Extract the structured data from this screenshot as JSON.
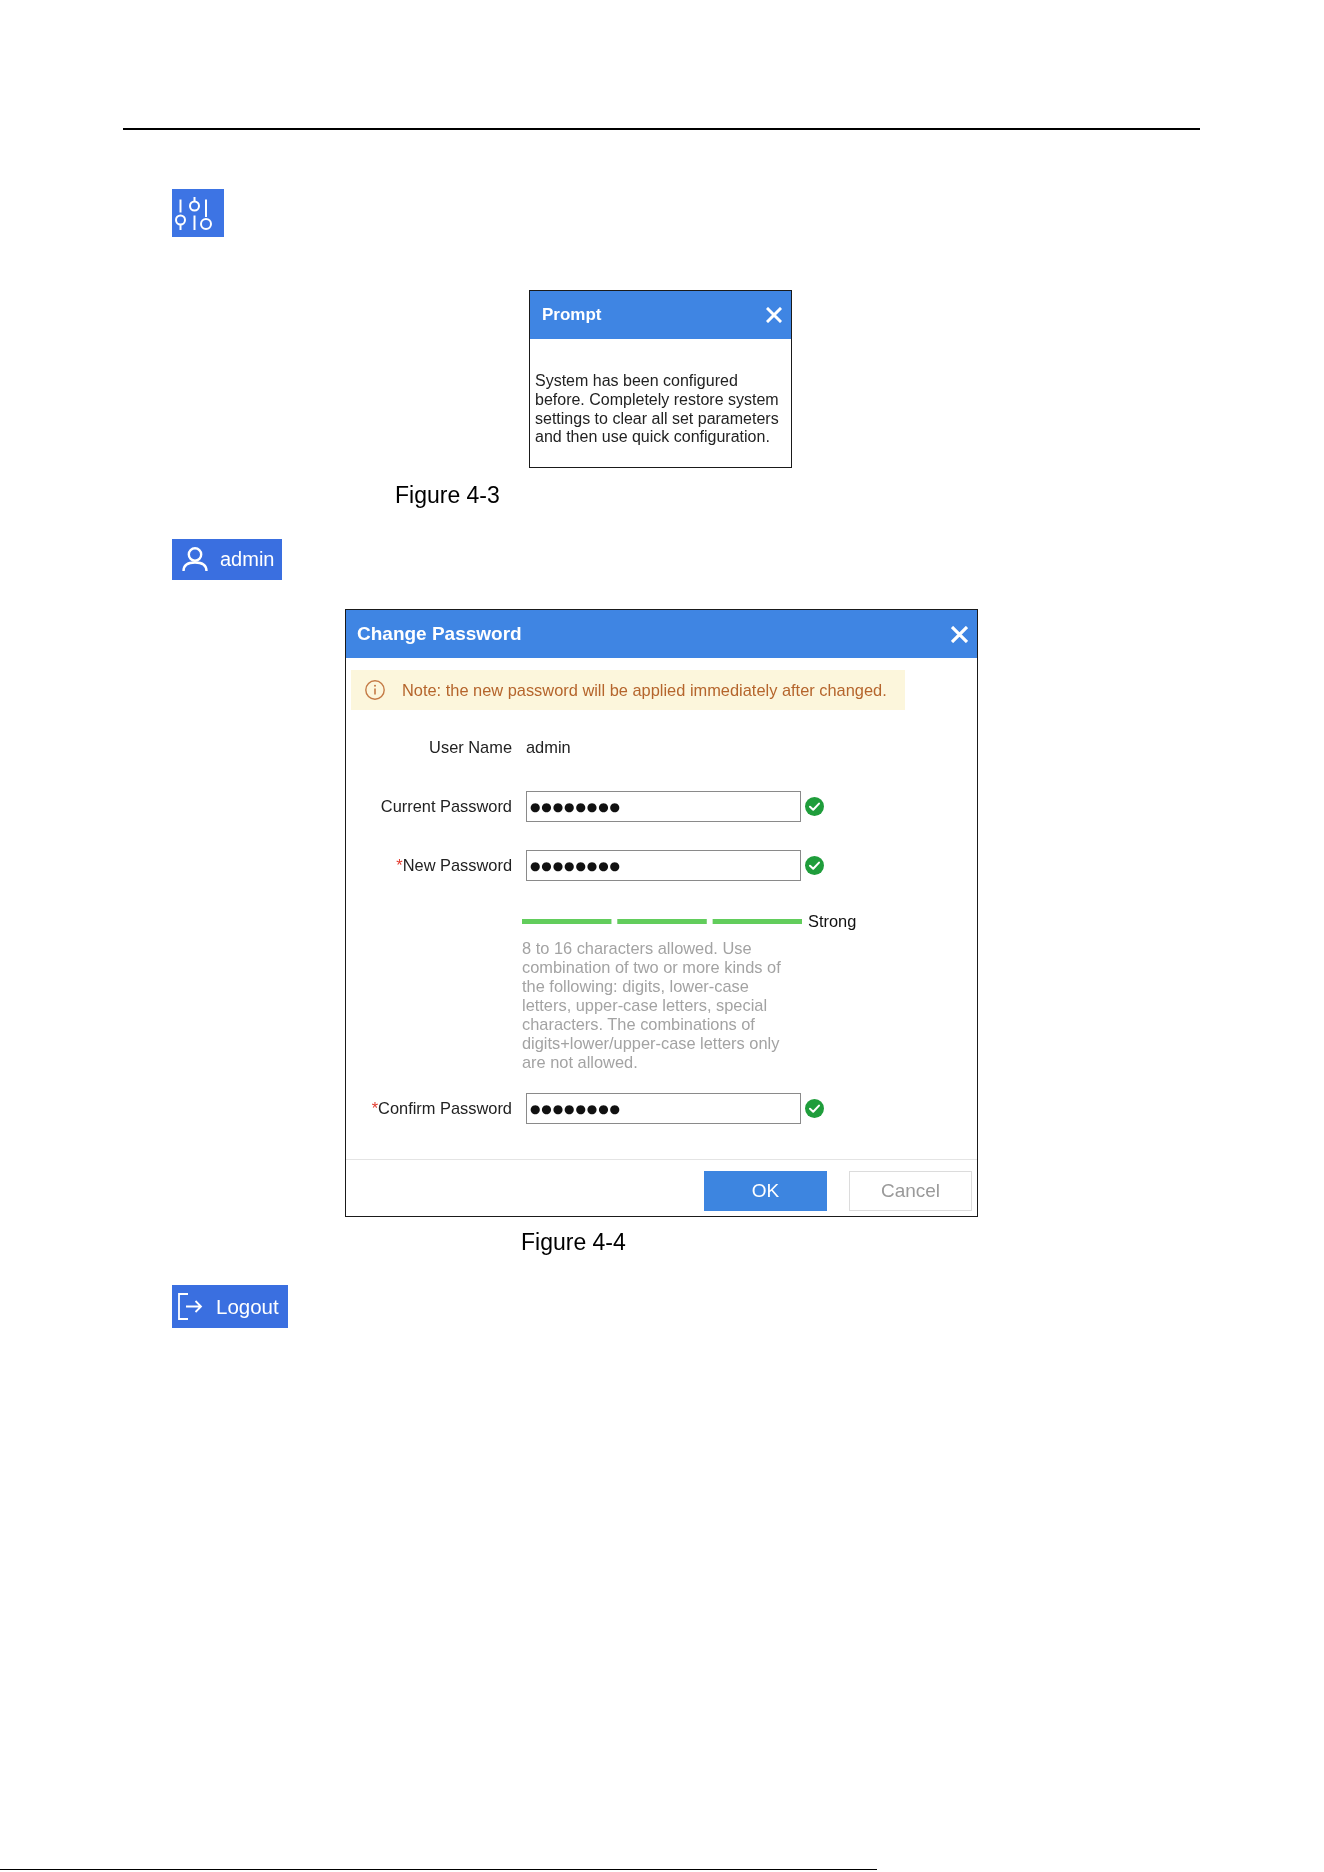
{
  "prompt_figure": {
    "dialog": {
      "title": "Prompt",
      "message": "System has been configured before. Completely restore system settings to clear all set parameters and then use quick configuration."
    },
    "caption": "Figure 4-3"
  },
  "user_button": {
    "label": "admin"
  },
  "password_figure": {
    "dialog": {
      "title": "Change Password",
      "note": "Note: the new password will be applied immediately after changed.",
      "fields": [
        {
          "kind": "text",
          "label": "User Name",
          "value": "admin"
        },
        {
          "kind": "password",
          "label": "Current Password",
          "value": "●●●●●●●●",
          "valid": true
        },
        {
          "kind": "password",
          "required_mark": "*",
          "label": "New Password",
          "value": "●●●●●●●●",
          "valid": true,
          "strength": {
            "level": 1,
            "label": "Strong"
          },
          "hint": "8 to 16 characters allowed. Use combination of two or more kinds of the following: digits, lower-case letters, upper-case letters, special characters. The combinations of digits+lower/upper-case letters only are not allowed."
        },
        {
          "kind": "password",
          "required_mark": "*",
          "label": "Confirm Password",
          "value": "●●●●●●●●",
          "valid": true
        }
      ],
      "buttons": [
        {
          "label": "OK",
          "primary": true
        },
        {
          "label": "Cancel",
          "primary": false
        }
      ]
    },
    "caption": "Figure 4-4"
  },
  "logout_button": {
    "label": "Logout"
  }
}
